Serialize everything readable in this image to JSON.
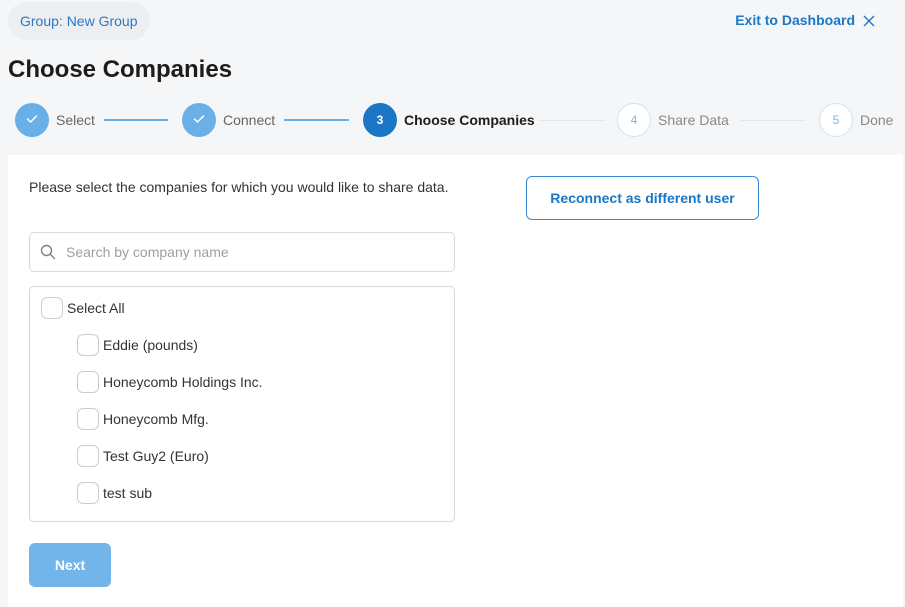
{
  "header": {
    "group_pill": "Group: New Group",
    "exit_label": "Exit to Dashboard"
  },
  "page_title": "Choose Companies",
  "stepper": {
    "steps": [
      {
        "number": "1",
        "label": "Select",
        "state": "complete"
      },
      {
        "number": "2",
        "label": "Connect",
        "state": "complete"
      },
      {
        "number": "3",
        "label": "Choose Companies",
        "state": "active"
      },
      {
        "number": "4",
        "label": "Share Data",
        "state": "upcoming"
      },
      {
        "number": "5",
        "label": "Done",
        "state": "upcoming"
      }
    ]
  },
  "main": {
    "instructions": "Please select the companies for which you would like to share data.",
    "reconnect_label": "Reconnect as different user",
    "search": {
      "placeholder": "Search by company name",
      "value": ""
    },
    "select_all_label": "Select All",
    "companies": [
      {
        "name": "Eddie (pounds)",
        "checked": false
      },
      {
        "name": "Honeycomb Holdings Inc.",
        "checked": false
      },
      {
        "name": "Honeycomb Mfg.",
        "checked": false
      },
      {
        "name": "Test Guy2 (Euro)",
        "checked": false
      },
      {
        "name": "test sub",
        "checked": false
      }
    ],
    "next_label": "Next"
  },
  "colors": {
    "primary": "#1b77c5",
    "complete_step": "#6ab0e8",
    "disabled_button": "#72b5ea",
    "background": "#f5f6f8"
  },
  "icons": {
    "check": "check-icon",
    "close": "close-icon",
    "search": "search-icon"
  }
}
